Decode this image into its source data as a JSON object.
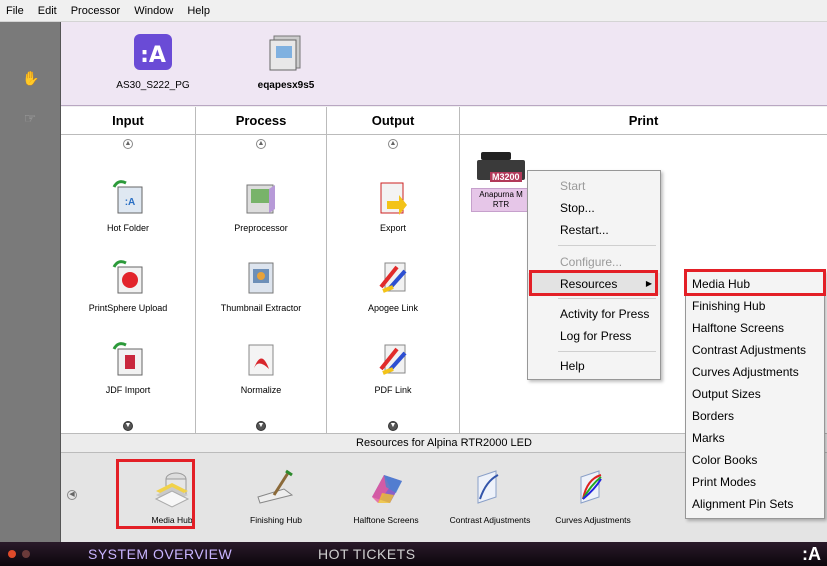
{
  "menubar": [
    "File",
    "Edit",
    "Processor",
    "Window",
    "Help"
  ],
  "jobs": [
    {
      "name": "AS30_S222_PG",
      "icon": "apogee-a-icon"
    },
    {
      "name": "eqapesx9s5",
      "icon": "document-stack-icon"
    }
  ],
  "columns": {
    "input": "Input",
    "process": "Process",
    "output": "Output",
    "print": "Print"
  },
  "input_items": [
    "Hot Folder",
    "PrintSphere Upload",
    "JDF Import"
  ],
  "process_items": [
    "Preprocessor",
    "Thumbnail Extractor",
    "Normalize"
  ],
  "output_items": [
    "Export",
    "Apogee Link",
    "PDF Link"
  ],
  "printer": {
    "badge": "M3200",
    "label_line1": "Anapurna M",
    "label_line2": "RTR"
  },
  "context_menu": {
    "start": "Start",
    "stop": "Stop...",
    "restart": "Restart...",
    "configure": "Configure...",
    "resources": "Resources",
    "activity": "Activity for Press",
    "log": "Log for Press",
    "help": "Help"
  },
  "submenu": [
    "Media Hub",
    "Finishing Hub",
    "Halftone Screens",
    "Contrast Adjustments",
    "Curves Adjustments",
    "Output Sizes",
    "Borders",
    "Marks",
    "Color Books",
    "Print Modes",
    "Alignment Pin Sets"
  ],
  "resources_title": "Resources for Alpina RTR2000 LED",
  "resources": [
    "Media Hub",
    "Finishing Hub",
    "Halftone Screens",
    "Contrast Adjustments",
    "Curves Adjustments"
  ],
  "taskbar": {
    "system": "SYSTEM OVERVIEW",
    "hot": "HOT TICKETS",
    "logo": ":A"
  }
}
